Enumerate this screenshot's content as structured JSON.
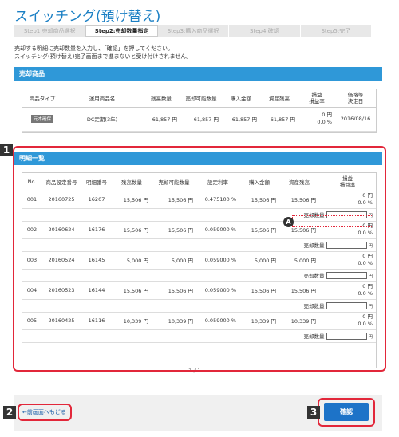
{
  "page": {
    "title": "スイッチング(預け替え)"
  },
  "steps": [
    "Step1:売却商品選択",
    "Step2:売却数量指定",
    "Step3:購入商品選択",
    "Step4:確認",
    "Step5:完了"
  ],
  "intro": {
    "line1": "売却する明細に売却数量を入力し、「確認」を押してください。",
    "line2": "スイッチング(預け替え)完了画面まで進まないと受け付けされません。"
  },
  "sale_product": {
    "header": "売却商品",
    "columns": [
      "商品タイプ",
      "運用商品名",
      "残高数量",
      "売却可能数量",
      "購入金額",
      "資産残高",
      "損益\n損益率",
      "価格等\n決定日"
    ],
    "row": {
      "type": "元本確保",
      "name": "DC定期(3年)",
      "balance_qty": "61,857 円",
      "sellable_qty": "61,857 円",
      "purchase": "61,857 円",
      "assets": "61,857 円",
      "pl": "0 円",
      "pl_rate": "0.0 %",
      "date": "2016/08/16"
    }
  },
  "detail": {
    "header": "明細一覧",
    "columns": [
      "No.",
      "商品設定番号",
      "明細番号",
      "残高数量",
      "売却可能数量",
      "設定利率",
      "購入金額",
      "資産残高",
      "損益\n損益率"
    ],
    "sell_label": "売却数量",
    "unit": "円",
    "rows": [
      {
        "no": "001",
        "set": "20160725",
        "detail_no": "16207",
        "bal": "15,506 円",
        "sellable": "15,506 円",
        "rate": "0.475100 %",
        "purchase": "15,506 円",
        "assets": "15,506 円",
        "pl": "0 円",
        "plr": "0.0 %"
      },
      {
        "no": "002",
        "set": "20160624",
        "detail_no": "16176",
        "bal": "15,506 円",
        "sellable": "15,506 円",
        "rate": "0.059000 %",
        "purchase": "15,506 円",
        "assets": "15,506 円",
        "pl": "0 円",
        "plr": "0.0 %"
      },
      {
        "no": "003",
        "set": "20160524",
        "detail_no": "16145",
        "bal": "5,000 円",
        "sellable": "5,000 円",
        "rate": "0.059000 %",
        "purchase": "5,000 円",
        "assets": "5,000 円",
        "pl": "0 円",
        "plr": "0.0 %"
      },
      {
        "no": "004",
        "set": "20160523",
        "detail_no": "16144",
        "bal": "15,506 円",
        "sellable": "15,506 円",
        "rate": "0.059000 %",
        "purchase": "15,506 円",
        "assets": "15,506 円",
        "pl": "0 円",
        "plr": "0.0 %"
      },
      {
        "no": "005",
        "set": "20160425",
        "detail_no": "16116",
        "bal": "10,339 円",
        "sellable": "10,339 円",
        "rate": "0.059000 %",
        "purchase": "10,339 円",
        "assets": "10,339 円",
        "pl": "0 円",
        "plr": "0.0 %"
      }
    ]
  },
  "pager": "1 / 1",
  "back_link": "←前画面へもどる",
  "confirm": "確認",
  "callouts": {
    "n1": "1",
    "n2": "2",
    "n3": "3",
    "a": "A"
  },
  "colors": {
    "accent": "#2f98d8",
    "title": "#1a7fc4",
    "highlight": "#e2273a",
    "button": "#1d73c8"
  }
}
